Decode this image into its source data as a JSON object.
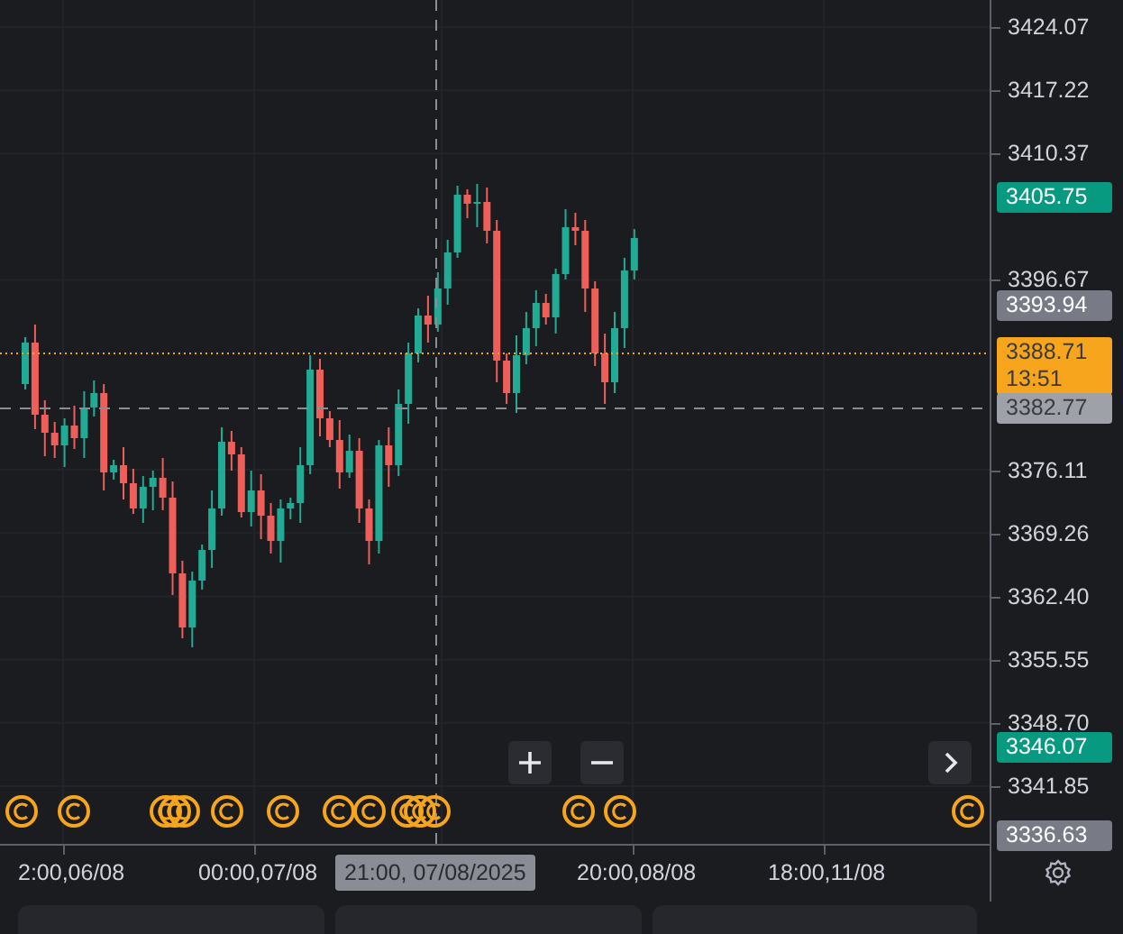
{
  "price_axis": {
    "ticks": [
      "3424.07",
      "3417.22",
      "3410.37",
      "3396.67",
      "3376.11",
      "3369.26",
      "3362.40",
      "3355.55",
      "3348.70",
      "3341.85"
    ]
  },
  "price_badges": [
    {
      "kind": "high",
      "text": "3405.75",
      "color": "#089981"
    },
    {
      "kind": "plain",
      "text": "3393.94",
      "color": "#787b86"
    },
    {
      "kind": "last",
      "text": "3388.71",
      "countdown": "13:51",
      "color": "#f7a51c"
    },
    {
      "kind": "crosshair",
      "text": "3382.77",
      "color": "#9ea1a8"
    },
    {
      "kind": "low",
      "text": "3346.07",
      "color": "#089981"
    },
    {
      "kind": "plain",
      "text": "3336.63",
      "color": "#787b86"
    }
  ],
  "time_axis": {
    "labels": [
      "2:00,06/08",
      "00:00,07/08",
      "20:00,08/08",
      "18:00,11/08"
    ],
    "crosshair_label": "21:00, 07/08/2025"
  }
}
